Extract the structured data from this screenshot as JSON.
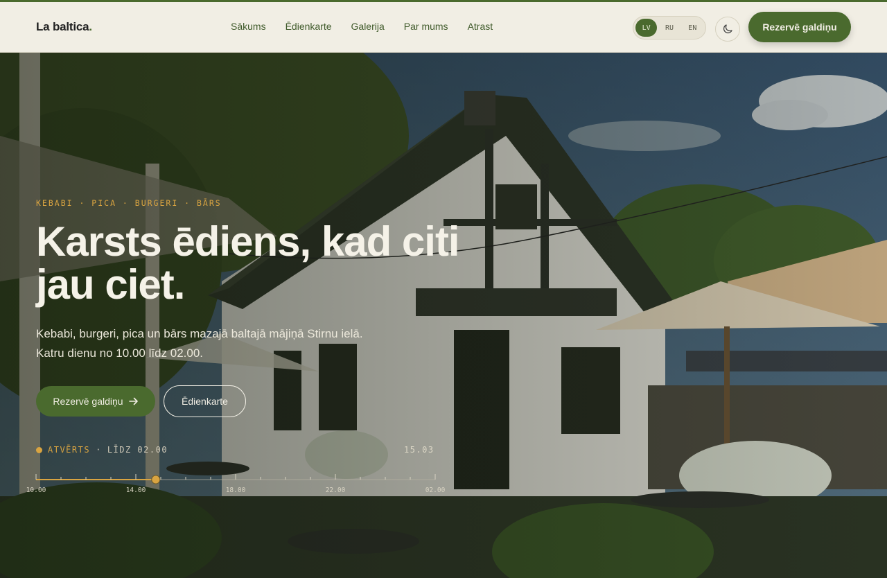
{
  "brand": {
    "name": "La baltica",
    "dot": "."
  },
  "nav": [
    "Sākums",
    "Ēdienkarte",
    "Galerija",
    "Par mums",
    "Atrast"
  ],
  "languages": {
    "items": [
      "LV",
      "RU",
      "EN"
    ],
    "active": "LV"
  },
  "header_cta": "Rezervē galdiņu",
  "hero": {
    "eyebrow": "KEBABI · PICA · BURGERI · BĀRS",
    "title_line1": "Karsts ēdiens, kad citi",
    "title_line2": "jau ciet.",
    "subtitle_line1": "Kebabi, burgeri, pica un bārs mazajā baltajā mājiņā Stirnu ielā.",
    "subtitle_line2": "Katru dienu no 10.00 līdz 02.00.",
    "primary_button": "Rezervē galdiņu",
    "primary_arrow": "→",
    "secondary_button": "Ēdienkarte"
  },
  "hours": {
    "status": "ATVĒRTS",
    "separator": "·",
    "until": "LĪDZ 02.00",
    "current_time": "15.03",
    "ticks": [
      "10.00",
      "14.00",
      "18.00",
      "22.00",
      "02.00"
    ],
    "progress_fraction": 0.3
  },
  "colors": {
    "accent": "#4a6a2e",
    "gold": "#d9a441",
    "cream": "#f1eee4"
  },
  "icons": {
    "theme_toggle": "moon-icon",
    "arrow": "arrow-right-icon"
  }
}
